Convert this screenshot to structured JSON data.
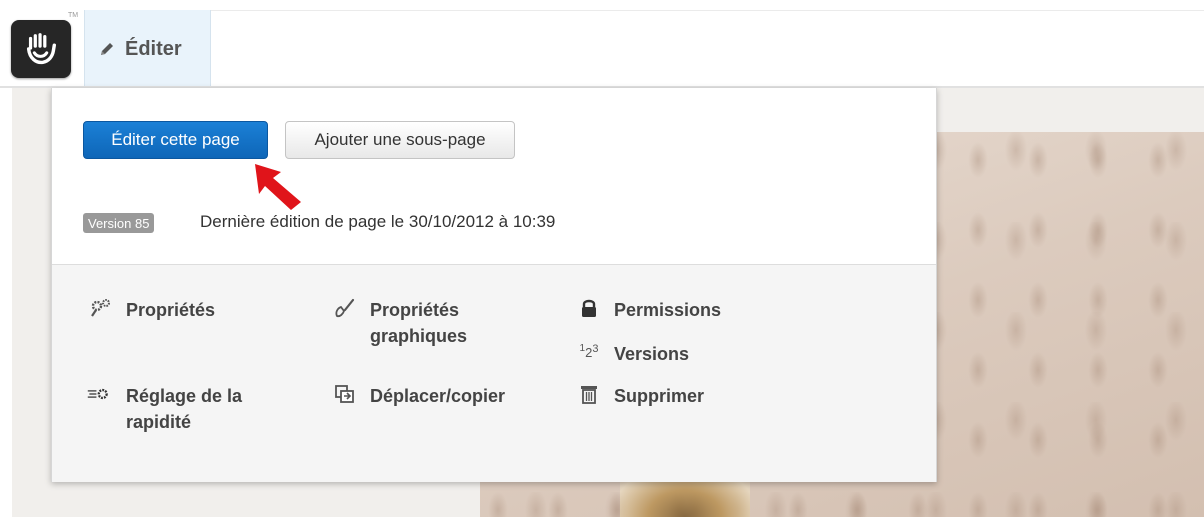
{
  "toolbar": {
    "logo_alt": "concrete5 logo",
    "trademark": "TM",
    "edit_tab_label": "Éditer"
  },
  "panel": {
    "edit_page_button": "Éditer cette page",
    "add_subpage_button": "Ajouter une sous-page",
    "version_badge": "Version 85",
    "last_edit_text": "Dernière édition de page le 30/10/2012 à 10:39"
  },
  "actions": {
    "properties": "Propriétés",
    "graphic_properties": "Propriétés graphiques",
    "permissions": "Permissions",
    "versions": "Versions",
    "speed_settings": "Réglage de la rapidité",
    "move_copy": "Déplacer/copier",
    "delete": "Supprimer"
  },
  "colors": {
    "primary_button": "#1475c9",
    "arrow": "#e0141a",
    "edit_tab_bg": "#e9f3fb",
    "badge_bg": "#999999"
  },
  "icons": {
    "properties": "gears-icon",
    "graphic_properties": "paint-brush-icon",
    "permissions": "lock-icon",
    "versions": "versions-123-icon",
    "speed_settings": "speed-gear-icon",
    "move_copy": "copy-icon",
    "delete": "trash-icon"
  }
}
